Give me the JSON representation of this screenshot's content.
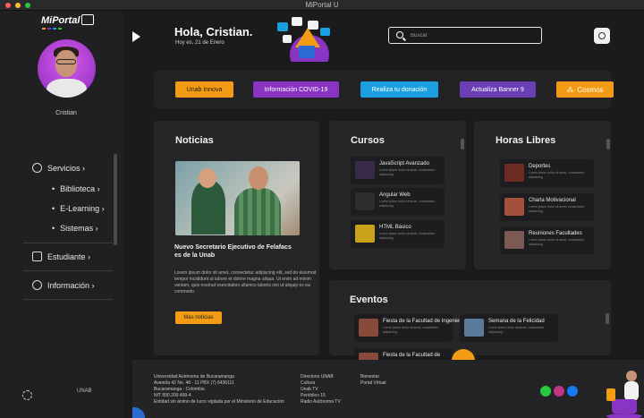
{
  "window": {
    "title": "MiPortal U"
  },
  "sidebar": {
    "logo": "MiPortal",
    "user_name": "Cristian",
    "nav": [
      {
        "label": "Servicios ›",
        "icon": "services-icon"
      },
      {
        "label": "Estudiante ›",
        "icon": "student-icon"
      },
      {
        "label": "Información ›",
        "icon": "info-icon"
      }
    ],
    "sub_items": [
      "Biblioteca ›",
      "E-Learning ›",
      "Sistemas ›"
    ],
    "footer_logo": "UNAB"
  },
  "header": {
    "greeting": "Hola, Cristian.",
    "date": "Hoy es, 21 de Enero",
    "search_placeholder": "Buscar"
  },
  "quick_buttons": [
    {
      "label": "Unab Innova",
      "color": "#f29b14",
      "text_color": "#2a1a00"
    },
    {
      "label": "Información COVID-19",
      "color": "#8a34c4",
      "text_color": "#ffffff"
    },
    {
      "label": "Realiza tu donación",
      "color": "#1aa0e0",
      "text_color": "#ffffff"
    },
    {
      "label": "Actualiza Banner 9",
      "color": "#6a3fb6",
      "text_color": "#ffffff"
    },
    {
      "label": "Cosmos",
      "color": "#f29b14",
      "text_color": "#ffffff"
    }
  ],
  "noticias": {
    "title": "Noticias",
    "headline": "Nuevo Secretario Ejecutivo de Felafacs es de la Unab",
    "body": "Lorem ipsum dolor sit amet, consectetur adipiscing elit, sed do eiusmod tempor incididunt ut labore et dolore magna aliqua. Ut enim ad minim veniam, quis nostrud exercitation ullamco laboris nisi ut aliquip ex ea commodo.",
    "more_label": "Mas noticias"
  },
  "cursos": {
    "title": "Cursos",
    "items": [
      {
        "title": "JavaScript Avanzado",
        "desc": "Lorem ipsum dolor sit amet, consectetur adipiscing.",
        "color": "#3a2a4a"
      },
      {
        "title": "Angular Web",
        "desc": "Lorem ipsum dolor sit amet, consectetur adipiscing.",
        "color": "#2c2c2c"
      },
      {
        "title": "HTML Básico",
        "desc": "Lorem ipsum dolor sit amet, consectetur adipiscing.",
        "color": "#c9a21a"
      }
    ]
  },
  "horas_libres": {
    "title": "Horas Libres",
    "items": [
      {
        "title": "Deportes",
        "desc": "Lorem ipsum dolor sit amet, consectetur adipiscing.",
        "color": "#6b2a22"
      },
      {
        "title": "Charla Motivacional",
        "desc": "Lorem ipsum dolor sit amet, consectetur adipiscing.",
        "color": "#a4503a"
      },
      {
        "title": "Reuniones Facultades",
        "desc": "Lorem ipsum dolor sit amet, consectetur adipiscing.",
        "color": "#7a5a52"
      }
    ]
  },
  "eventos": {
    "title": "Eventos",
    "items": [
      {
        "title": "Fiesta de la Facultad de Ingeniería",
        "desc": "Lorem ipsum dolor sit amet, consectetur adipiscing.",
        "color": "#8a4a3a"
      },
      {
        "title": "Semana de la Felicidad",
        "desc": "Lorem ipsum dolor sit amet, consectetur adipiscing.",
        "color": "#5a7a9a"
      },
      {
        "title": "Fiesta de la Facultad de",
        "desc": "",
        "color": "#8a4a3a"
      }
    ]
  },
  "footer": {
    "col1": "Universidad Autónoma de Bucaramanga\nAvenida 42 No. 48 - 11 PBX (7) 6436111\nBucaramanga - Colombia\nNIT 890.200.499-4\nEntidad sin ánimo de lucro vigilada por el Ministerio de Educación",
    "col2": "Directorio UNAB\nCultura\nUnab TV\nPeriódico 15\nRadio Autónoma TV",
    "col3": "Bienestar\nPortal Virtual"
  }
}
